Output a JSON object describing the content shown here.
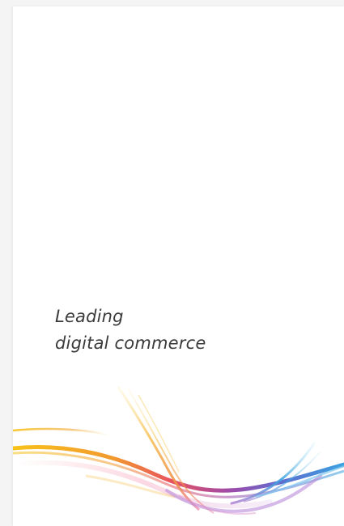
{
  "brand_card": {
    "tagline_line1": "Leading",
    "tagline_line2": "digital commerce"
  },
  "decoration": {
    "icon": "rainbow-swoosh-icon",
    "colors": [
      "#f7c21a",
      "#f29a2e",
      "#e8525f",
      "#a04aa8",
      "#6a5bc4",
      "#3aa3e0",
      "#8fd0f2"
    ]
  }
}
